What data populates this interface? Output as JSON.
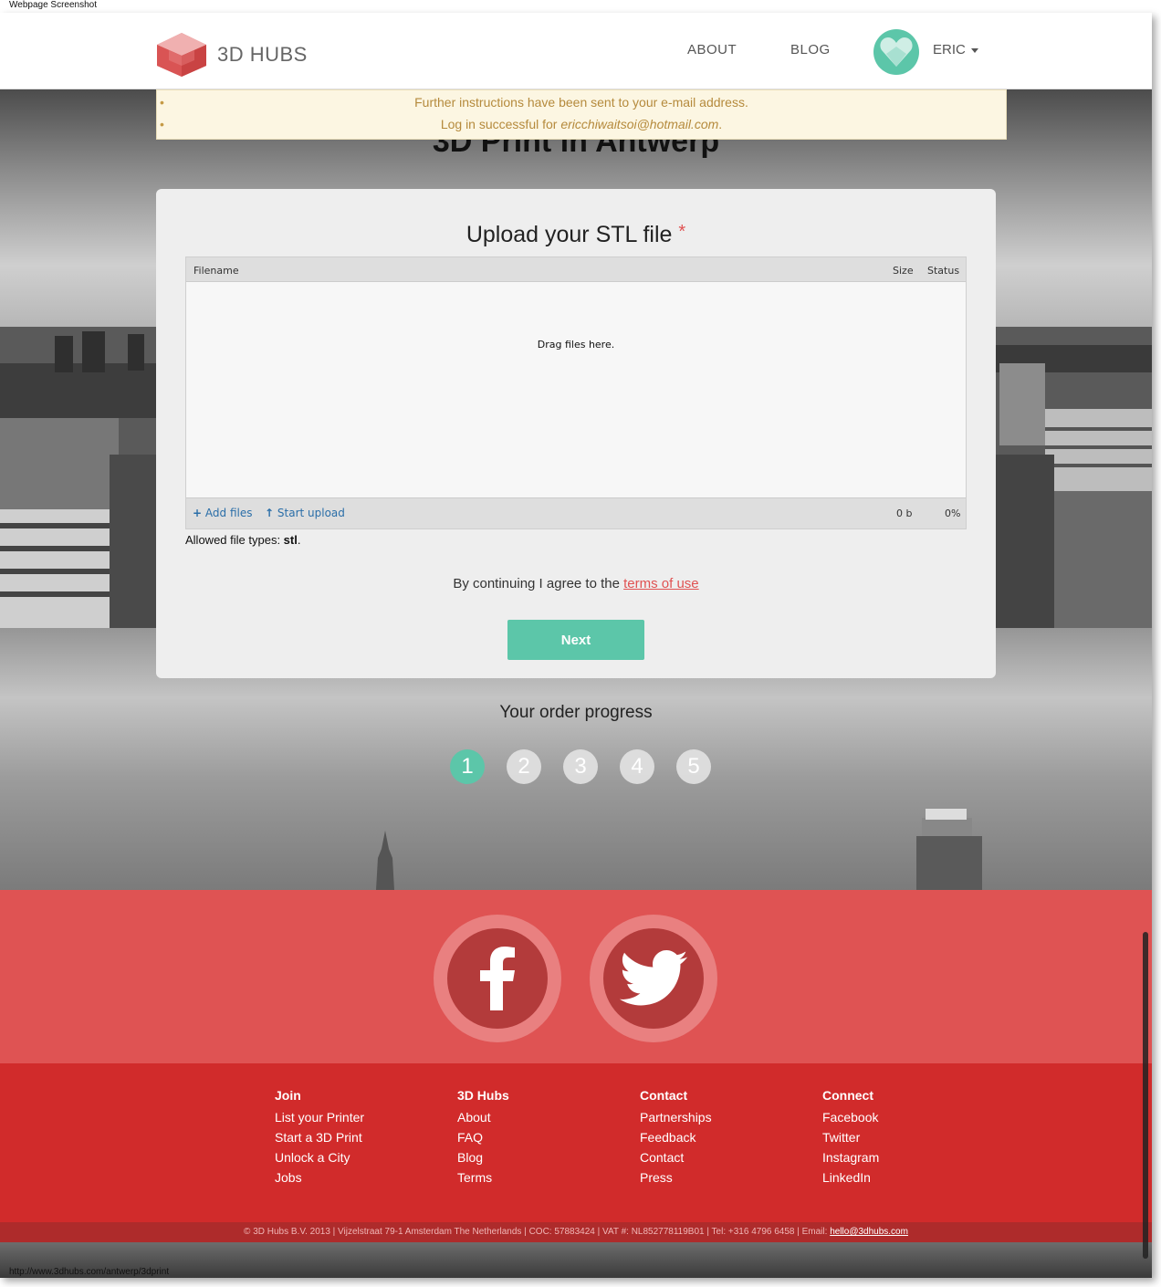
{
  "caption": "Webpage Screenshot",
  "status_url": "http://www.3dhubs.com/antwerp/3dprint",
  "brand": {
    "name": "3D HUBS",
    "accent": "#5cc6a9",
    "red": "#df5353"
  },
  "nav": {
    "about": "ABOUT",
    "blog": "BLOG",
    "user": "ERIC"
  },
  "flash": {
    "line1": "Further instructions have been sent to your e-mail address.",
    "line2_prefix": "Log in successful for ",
    "line2_email": "ericchiwaitsoi@hotmail.com",
    "line2_suffix": "."
  },
  "page_title": "3D Print in Antwerp",
  "upload": {
    "title": "Upload your STL file",
    "required_mark": "*",
    "col_filename": "Filename",
    "col_size": "Size",
    "col_status": "Status",
    "drop_text": "Drag files here.",
    "add_files": "Add files",
    "start_upload": "Start upload",
    "total_size": "0 b",
    "total_status": "0%",
    "allowed_prefix": "Allowed file types: ",
    "allowed_types": "stl",
    "allowed_suffix": "."
  },
  "agree": {
    "prefix": "By continuing I agree to the ",
    "link": "terms of use"
  },
  "next_label": "Next",
  "progress": {
    "title": "Your order progress",
    "steps": [
      "1",
      "2",
      "3",
      "4",
      "5"
    ],
    "current": 1
  },
  "footer": {
    "columns": [
      {
        "heading": "Join",
        "links": [
          "List your Printer",
          "Start a 3D Print",
          "Unlock a City",
          "Jobs"
        ]
      },
      {
        "heading": "3D Hubs",
        "links": [
          "About",
          "FAQ",
          "Blog",
          "Terms"
        ]
      },
      {
        "heading": "Contact",
        "links": [
          "Partnerships",
          "Feedback",
          "Contact",
          "Press"
        ]
      },
      {
        "heading": "Connect",
        "links": [
          "Facebook",
          "Twitter",
          "Instagram",
          "LinkedIn"
        ]
      }
    ],
    "copyright": "© 3D Hubs B.V. 2013  |  Vijzelstraat 79-1 Amsterdam The Netherlands  |  COC: 57883424  |  VAT #: NL852778119B01  |  Tel: +316 4796 6458  |  Email: ",
    "email": "hello@3dhubs.com"
  },
  "icons": {
    "facebook": "facebook-icon",
    "twitter": "twitter-icon"
  }
}
